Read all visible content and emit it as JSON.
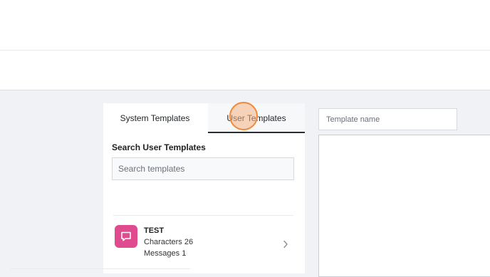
{
  "tabs": [
    {
      "label": "System Templates"
    },
    {
      "label": "User Templates"
    }
  ],
  "search": {
    "label": "Search User Templates",
    "placeholder": "Search templates"
  },
  "templates": [
    {
      "title": "TEST",
      "characters": "Characters 26",
      "messages": "Messages 1",
      "icon": "chat-bubble-icon",
      "icon_color": "#e04a8e"
    }
  ],
  "editor": {
    "name_placeholder": "Template name"
  },
  "colors": {
    "accent": "#2a2e33",
    "cursor": "#f08a3a"
  }
}
